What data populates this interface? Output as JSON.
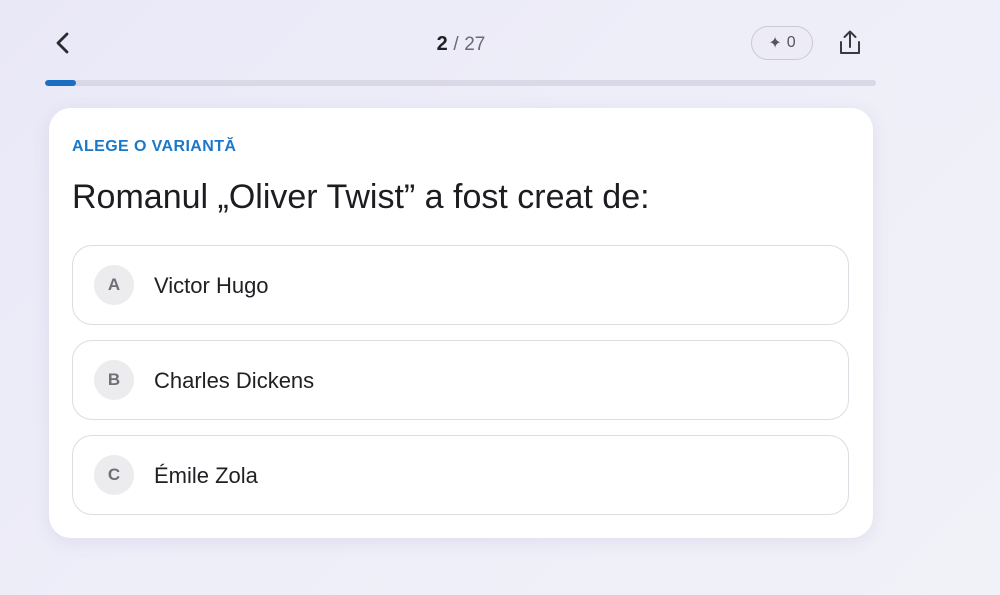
{
  "header": {
    "back_icon": "chevron-left-icon",
    "counter": {
      "current": "2",
      "separator": "/",
      "total": "27"
    },
    "score": {
      "icon": "sparkle-icon",
      "value": "0"
    },
    "share_icon": "share-icon"
  },
  "progress": {
    "fraction": 0.037,
    "color": "#1b6ec2"
  },
  "card": {
    "prompt_label": "ALEGE O VARIANTĂ",
    "question": "Romanul „Oliver Twist” a fost creat de:",
    "options": [
      {
        "letter": "A",
        "text": "Victor Hugo"
      },
      {
        "letter": "B",
        "text": "Charles Dickens"
      },
      {
        "letter": "C",
        "text": "Émile Zola"
      }
    ]
  },
  "colors": {
    "accent": "#1b78c8",
    "background": "#ecebf7"
  }
}
